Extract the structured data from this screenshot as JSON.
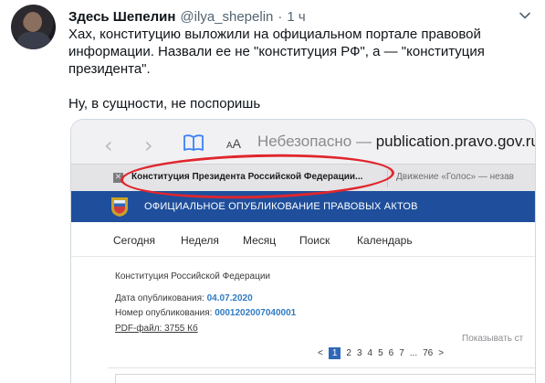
{
  "tweet": {
    "author_name": "Здесь Шепелин",
    "handle": "@ilya_shepelin",
    "separator": "·",
    "time": "1 ч",
    "text_lines": [
      "Хах, конституцию выложили на официальном портале правовой",
      "информации. Назвали ее не \"конституция РФ\", а — \"конституция",
      "президента\"."
    ],
    "text_line_2": "Ну, в сущности, не поспоришь"
  },
  "screenshot": {
    "browser": {
      "back_icon": "chevron-left-icon",
      "forward_icon": "chevron-right-icon",
      "reader_icon": "book-icon",
      "aa_label_small": "A",
      "aa_label_big": "A",
      "insecure_label": "Небезопасно —",
      "host": "publication.pravo.gov.ru"
    },
    "tabs": {
      "close_glyph": "✕",
      "active_title": "Конституция Президента Российской Федерации...",
      "other_title": "Движение «Голос» — незав"
    },
    "site": {
      "banner_title": "ОФИЦИАЛЬНОЕ ОПУБЛИКОВАНИЕ ПРАВОВЫХ АКТОВ",
      "nav": [
        "Сегодня",
        "Неделя",
        "Месяц",
        "Поиск",
        "Календарь"
      ]
    },
    "document": {
      "title": "Конституция Российской Федерации",
      "published_label": "Дата опубликования:",
      "published_value": "04.07.2020",
      "number_label": "Номер опубликования:",
      "number_value": "0001202007040001",
      "pdf_link": "PDF-файл: 3755 Кб",
      "show_label": "Показывать ст",
      "pager_prev": "<",
      "pager_pages": [
        "1",
        "2",
        "3",
        "4",
        "5",
        "6",
        "7",
        "...",
        "76"
      ],
      "pager_next": ">",
      "current_page": "1"
    },
    "annotation_color": "#e0262d"
  },
  "colors": {
    "accent_banner": "#1f4f9c",
    "link": "#2f7bc2",
    "muted": "#536471"
  }
}
